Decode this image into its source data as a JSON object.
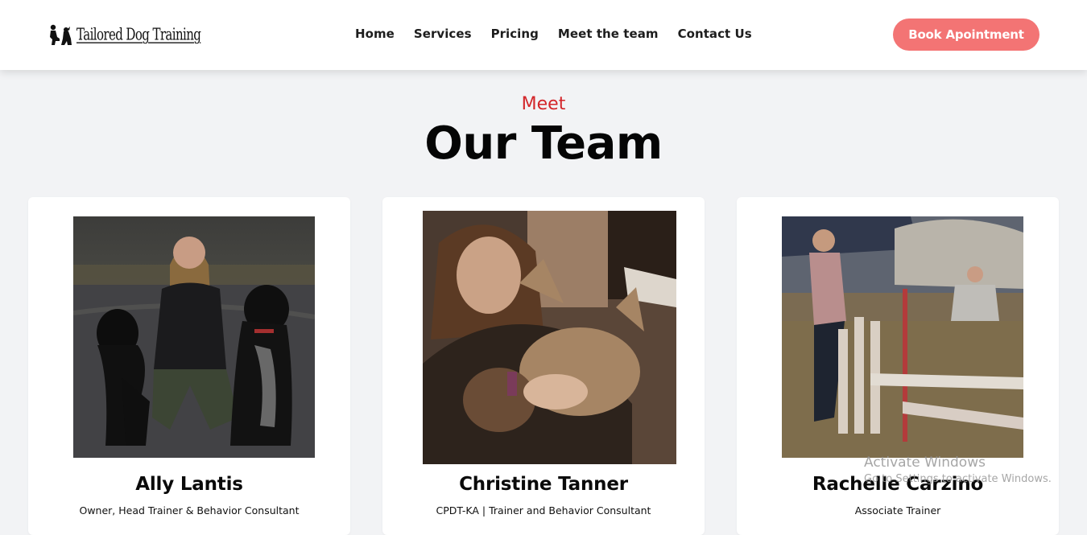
{
  "header": {
    "logo_text": "Tailored Dog Training",
    "nav": [
      "Home",
      "Services",
      "Pricing",
      "Meet the team",
      "Contact Us"
    ],
    "cta_label": "Book Apointment"
  },
  "section": {
    "eyebrow": "Meet",
    "title": "Our Team"
  },
  "team": [
    {
      "name": "Ally Lantis",
      "role": "Owner, Head Trainer & Behavior Consultant"
    },
    {
      "name": "Christine Tanner",
      "role": "CPDT-KA | Trainer and Behavior Consultant"
    },
    {
      "name": "Rachelle Carzino",
      "role": "Associate Trainer"
    }
  ],
  "watermark": {
    "title": "Activate Windows",
    "subtitle": "Go to Settings to activate Windows."
  },
  "colors": {
    "accent": "#f37474",
    "eyebrow": "#d3262a",
    "page_bg": "#f2f3f5"
  }
}
